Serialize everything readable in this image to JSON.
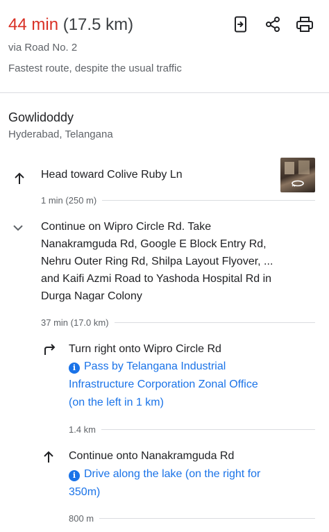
{
  "summary": {
    "duration": "44 min",
    "distance": "(17.5 km)",
    "via": "via Road No. 2",
    "note": "Fastest route, despite the usual traffic"
  },
  "header_actions": [
    {
      "icon": "send-to-device-icon"
    },
    {
      "icon": "share-icon"
    },
    {
      "icon": "print-icon"
    }
  ],
  "origin": {
    "name": "Gowlidoddy",
    "region": "Hyderabad, Telangana"
  },
  "steps": [
    {
      "icon": "arrow-up-icon",
      "text": "Head toward Colive Ruby Ln",
      "distance": "1 min (250 m)",
      "thumbnail_icon": "street-view-360-icon"
    },
    {
      "icon": "chevron-down-icon",
      "text_lines": [
        "Continue on Wipro Circle Rd. Take",
        "Nanakramguda Rd, Google E Block Entry Rd,",
        "Nehru Outer Ring Rd, Shilpa Layout Flyover, ...",
        "and Kaifi Azmi Road to Yashoda Hospital Rd in",
        "Durga Nagar Colony"
      ],
      "distance": "37 min (17.0 km)"
    }
  ],
  "substeps": [
    {
      "icon": "turn-right-icon",
      "text": "Turn right onto Wipro Circle Rd",
      "note_lines": [
        "Pass by Telangana Industrial",
        "Infrastructure Corporation Zonal Office",
        "(on the left in 1 km)"
      ],
      "distance": "1.4 km"
    },
    {
      "icon": "arrow-up-icon",
      "text": "Continue onto Nanakramguda Rd",
      "note_lines": [
        "Drive along the lake (on the right for",
        "350m)"
      ],
      "distance": "800 m"
    }
  ],
  "colors": {
    "duration": "#d93025",
    "link": "#1a73e8",
    "secondary_text": "#5f6368",
    "divider": "#dadce0"
  }
}
